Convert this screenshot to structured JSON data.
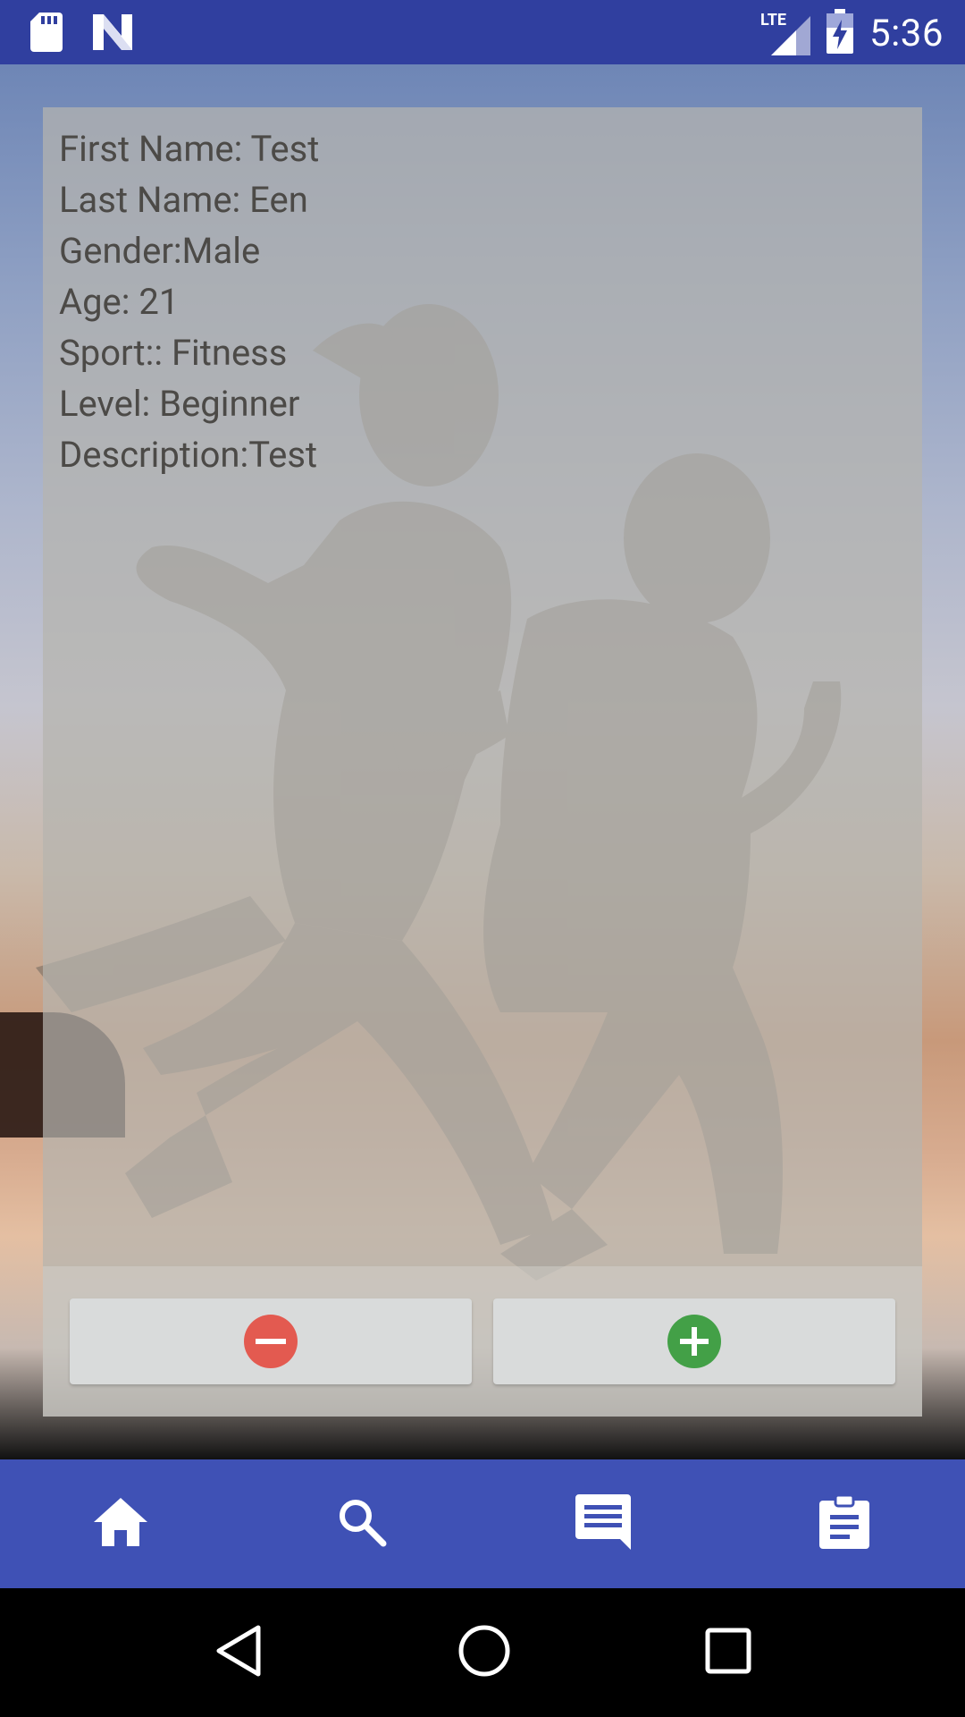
{
  "status_bar": {
    "time": "5:36",
    "network": "LTE",
    "icons": [
      "sd-card-icon",
      "n-logo-icon",
      "signal-icon",
      "battery-charging-icon"
    ]
  },
  "profile": {
    "lines": [
      "First Name: Test",
      "Last Name: Een",
      "Gender:Male",
      "Age: 21",
      "Sport:: Fitness",
      "Level: Beginner",
      "Description:Test"
    ]
  },
  "actions": {
    "dislike_icon": "minus-circle-icon",
    "like_icon": "plus-circle-icon",
    "colors": {
      "dislike": "#E35A50",
      "like": "#43A047"
    }
  },
  "bottom_nav": {
    "items": [
      "home-icon",
      "search-icon",
      "chat-icon",
      "assignment-icon"
    ],
    "color": "#3F51B5"
  },
  "system_nav": {
    "items": [
      "back-icon",
      "home-circle-icon",
      "recents-icon"
    ]
  }
}
